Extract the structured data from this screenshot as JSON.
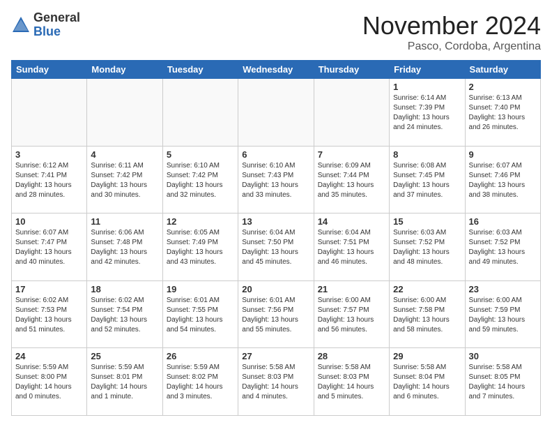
{
  "header": {
    "logo": {
      "general": "General",
      "blue": "Blue"
    },
    "title": "November 2024",
    "location": "Pasco, Cordoba, Argentina"
  },
  "weekdays": [
    "Sunday",
    "Monday",
    "Tuesday",
    "Wednesday",
    "Thursday",
    "Friday",
    "Saturday"
  ],
  "weeks": [
    [
      {
        "day": "",
        "info": ""
      },
      {
        "day": "",
        "info": ""
      },
      {
        "day": "",
        "info": ""
      },
      {
        "day": "",
        "info": ""
      },
      {
        "day": "",
        "info": ""
      },
      {
        "day": "1",
        "info": "Sunrise: 6:14 AM\nSunset: 7:39 PM\nDaylight: 13 hours\nand 24 minutes."
      },
      {
        "day": "2",
        "info": "Sunrise: 6:13 AM\nSunset: 7:40 PM\nDaylight: 13 hours\nand 26 minutes."
      }
    ],
    [
      {
        "day": "3",
        "info": "Sunrise: 6:12 AM\nSunset: 7:41 PM\nDaylight: 13 hours\nand 28 minutes."
      },
      {
        "day": "4",
        "info": "Sunrise: 6:11 AM\nSunset: 7:42 PM\nDaylight: 13 hours\nand 30 minutes."
      },
      {
        "day": "5",
        "info": "Sunrise: 6:10 AM\nSunset: 7:42 PM\nDaylight: 13 hours\nand 32 minutes."
      },
      {
        "day": "6",
        "info": "Sunrise: 6:10 AM\nSunset: 7:43 PM\nDaylight: 13 hours\nand 33 minutes."
      },
      {
        "day": "7",
        "info": "Sunrise: 6:09 AM\nSunset: 7:44 PM\nDaylight: 13 hours\nand 35 minutes."
      },
      {
        "day": "8",
        "info": "Sunrise: 6:08 AM\nSunset: 7:45 PM\nDaylight: 13 hours\nand 37 minutes."
      },
      {
        "day": "9",
        "info": "Sunrise: 6:07 AM\nSunset: 7:46 PM\nDaylight: 13 hours\nand 38 minutes."
      }
    ],
    [
      {
        "day": "10",
        "info": "Sunrise: 6:07 AM\nSunset: 7:47 PM\nDaylight: 13 hours\nand 40 minutes."
      },
      {
        "day": "11",
        "info": "Sunrise: 6:06 AM\nSunset: 7:48 PM\nDaylight: 13 hours\nand 42 minutes."
      },
      {
        "day": "12",
        "info": "Sunrise: 6:05 AM\nSunset: 7:49 PM\nDaylight: 13 hours\nand 43 minutes."
      },
      {
        "day": "13",
        "info": "Sunrise: 6:04 AM\nSunset: 7:50 PM\nDaylight: 13 hours\nand 45 minutes."
      },
      {
        "day": "14",
        "info": "Sunrise: 6:04 AM\nSunset: 7:51 PM\nDaylight: 13 hours\nand 46 minutes."
      },
      {
        "day": "15",
        "info": "Sunrise: 6:03 AM\nSunset: 7:52 PM\nDaylight: 13 hours\nand 48 minutes."
      },
      {
        "day": "16",
        "info": "Sunrise: 6:03 AM\nSunset: 7:52 PM\nDaylight: 13 hours\nand 49 minutes."
      }
    ],
    [
      {
        "day": "17",
        "info": "Sunrise: 6:02 AM\nSunset: 7:53 PM\nDaylight: 13 hours\nand 51 minutes."
      },
      {
        "day": "18",
        "info": "Sunrise: 6:02 AM\nSunset: 7:54 PM\nDaylight: 13 hours\nand 52 minutes."
      },
      {
        "day": "19",
        "info": "Sunrise: 6:01 AM\nSunset: 7:55 PM\nDaylight: 13 hours\nand 54 minutes."
      },
      {
        "day": "20",
        "info": "Sunrise: 6:01 AM\nSunset: 7:56 PM\nDaylight: 13 hours\nand 55 minutes."
      },
      {
        "day": "21",
        "info": "Sunrise: 6:00 AM\nSunset: 7:57 PM\nDaylight: 13 hours\nand 56 minutes."
      },
      {
        "day": "22",
        "info": "Sunrise: 6:00 AM\nSunset: 7:58 PM\nDaylight: 13 hours\nand 58 minutes."
      },
      {
        "day": "23",
        "info": "Sunrise: 6:00 AM\nSunset: 7:59 PM\nDaylight: 13 hours\nand 59 minutes."
      }
    ],
    [
      {
        "day": "24",
        "info": "Sunrise: 5:59 AM\nSunset: 8:00 PM\nDaylight: 14 hours\nand 0 minutes."
      },
      {
        "day": "25",
        "info": "Sunrise: 5:59 AM\nSunset: 8:01 PM\nDaylight: 14 hours\nand 1 minute."
      },
      {
        "day": "26",
        "info": "Sunrise: 5:59 AM\nSunset: 8:02 PM\nDaylight: 14 hours\nand 3 minutes."
      },
      {
        "day": "27",
        "info": "Sunrise: 5:58 AM\nSunset: 8:03 PM\nDaylight: 14 hours\nand 4 minutes."
      },
      {
        "day": "28",
        "info": "Sunrise: 5:58 AM\nSunset: 8:03 PM\nDaylight: 14 hours\nand 5 minutes."
      },
      {
        "day": "29",
        "info": "Sunrise: 5:58 AM\nSunset: 8:04 PM\nDaylight: 14 hours\nand 6 minutes."
      },
      {
        "day": "30",
        "info": "Sunrise: 5:58 AM\nSunset: 8:05 PM\nDaylight: 14 hours\nand 7 minutes."
      }
    ]
  ]
}
